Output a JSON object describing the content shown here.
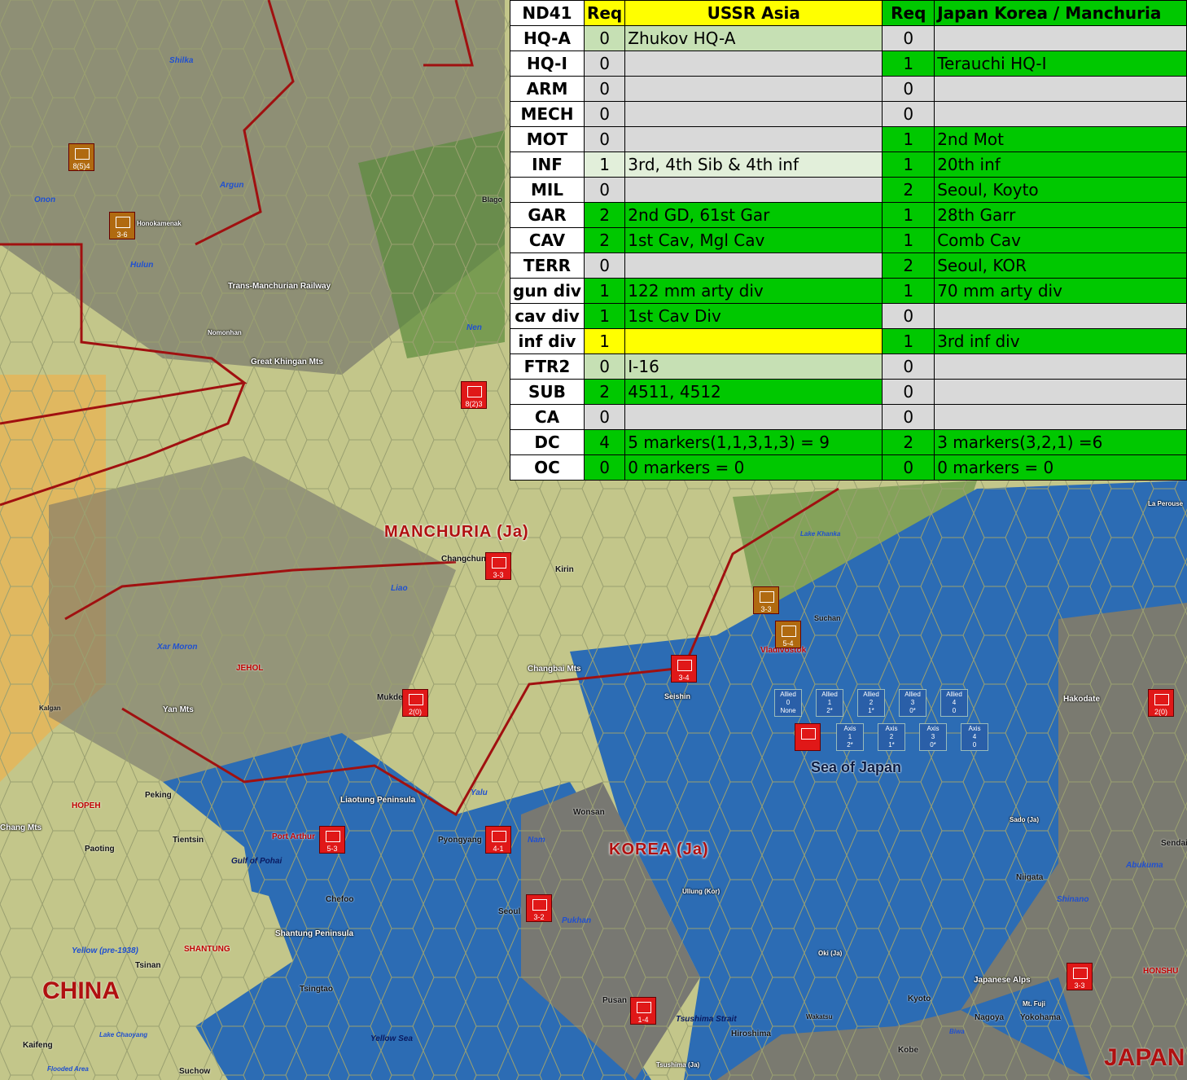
{
  "table": {
    "headers": [
      "ND41",
      "Req",
      "USSR Asia",
      "Req",
      "Japan Korea / Manchuria"
    ],
    "rows": [
      {
        "k": "HQ-A",
        "ur": "0",
        "u": "Zhukov HQ-A",
        "jr": "0",
        "j": ""
      },
      {
        "k": "HQ-I",
        "ur": "0",
        "u": "",
        "jr": "1",
        "j": "Terauchi HQ-I"
      },
      {
        "k": "ARM",
        "ur": "0",
        "u": "",
        "jr": "0",
        "j": ""
      },
      {
        "k": "MECH",
        "ur": "0",
        "u": "",
        "jr": "0",
        "j": ""
      },
      {
        "k": "MOT",
        "ur": "0",
        "u": "",
        "jr": "1",
        "j": "2nd Mot"
      },
      {
        "k": "INF",
        "ur": "1",
        "u": "3rd, 4th Sib & 4th inf",
        "jr": "1",
        "j": "20th inf"
      },
      {
        "k": "MIL",
        "ur": "0",
        "u": "",
        "jr": "2",
        "j": "Seoul, Koyto"
      },
      {
        "k": "GAR",
        "ur": "2",
        "u": "2nd GD, 61st Gar",
        "jr": "1",
        "j": "28th Garr"
      },
      {
        "k": "CAV",
        "ur": "2",
        "u": "1st Cav, Mgl Cav",
        "jr": "1",
        "j": "Comb Cav"
      },
      {
        "k": "TERR",
        "ur": "0",
        "u": "",
        "jr": "2",
        "j": "Seoul, KOR"
      },
      {
        "k": "gun div",
        "ur": "1",
        "u": "122 mm arty div",
        "jr": "1",
        "j": "70 mm arty div"
      },
      {
        "k": "cav div",
        "ur": "1",
        "u": "1st Cav Div",
        "jr": "0",
        "j": ""
      },
      {
        "k": "inf div",
        "ur": "1",
        "u": "",
        "jr": "1",
        "j": "3rd inf div"
      },
      {
        "k": "FTR2",
        "ur": "0",
        "u": "I-16",
        "jr": "0",
        "j": ""
      },
      {
        "k": "SUB",
        "ur": "2",
        "u": "4511, 4512",
        "jr": "0",
        "j": ""
      },
      {
        "k": "CA",
        "ur": "0",
        "u": "",
        "jr": "0",
        "j": ""
      },
      {
        "k": "DC",
        "ur": "4",
        "u": "5 markers(1,1,3,1,3) = 9",
        "jr": "2",
        "j": "3 markers(3,2,1) =6"
      },
      {
        "k": "OC",
        "ur": "0",
        "u": "0 markers = 0",
        "jr": "0",
        "j": "0 markers = 0"
      }
    ]
  },
  "map": {
    "regions": [
      "MANCHURIA (Ja)",
      "KOREA (Ja)",
      "CHINA",
      "JAPAN"
    ],
    "seas": [
      "Sea of Japan",
      "Yellow Sea",
      "Gulf of Pohai",
      "Tsushima Strait"
    ],
    "places": [
      "Changchun",
      "Kirin",
      "Mukden",
      "Peking",
      "Tientsin",
      "Paoting",
      "Port Arthur",
      "Pyongyang",
      "Seoul",
      "Wonsan",
      "Pusan",
      "Chefoo",
      "Tsinan",
      "Tsingtao",
      "Kaifeng",
      "Kalgan",
      "Suchan",
      "Vladivostok",
      "Seishin",
      "Hakodate",
      "Niigata",
      "Kyoto",
      "Kobe",
      "Nagoya",
      "Yokohama",
      "Hiroshima",
      "Wakatsu",
      "Nomonhan",
      "Blago",
      "Sado (Ja)",
      "Oki (Ja)",
      "Ullung (Kor)",
      "Tsushima (Ja)",
      "La Perouse",
      "Sendai",
      "Suchow",
      "Lake Khanka",
      "Lake Chaoyang",
      "Flooded Area",
      "HONSHU",
      "Japanese Alps",
      "Biwa",
      "Mt. Fuji"
    ],
    "features": [
      "Trans-Manchurian Railway",
      "Great Khingan Mts",
      "Changbai Mts",
      "Yan Mts",
      "Liaotung Peninsula",
      "Shantung Peninsula",
      "JEHOL",
      "HOPEH",
      "SHANTUNG",
      "Yellow (pre-1938)",
      "Shilka",
      "Argun",
      "Onon",
      "Hulun",
      "Nen",
      "Liao",
      "Xar Moron",
      "Yalu",
      "Nam",
      "Pukhan",
      "Shinano",
      "Abukuma",
      "Chang Mts",
      "Honokamenak"
    ],
    "counters": [
      "8(5)4",
      "3-6",
      "8(2)3",
      "3-3",
      "3-3",
      "5-4",
      "3-4",
      "2(0)",
      "5-3",
      "4-1",
      "3-2",
      "1-4",
      "2(0)",
      "3-3"
    ],
    "tracks": {
      "allied": [
        {
          "t": "Allied",
          "n": "0",
          "v": "None"
        },
        {
          "t": "Allied",
          "n": "1",
          "v": "2*"
        },
        {
          "t": "Allied",
          "n": "2",
          "v": "1*"
        },
        {
          "t": "Allied",
          "n": "3",
          "v": "0*"
        },
        {
          "t": "Allied",
          "n": "4",
          "v": "0"
        }
      ],
      "axis": [
        {
          "t": "Axis",
          "n": "1",
          "v": "2*"
        },
        {
          "t": "Axis",
          "n": "2",
          "v": "1*"
        },
        {
          "t": "Axis",
          "n": "3",
          "v": "0*"
        },
        {
          "t": "Axis",
          "n": "4",
          "v": "0"
        }
      ]
    }
  }
}
